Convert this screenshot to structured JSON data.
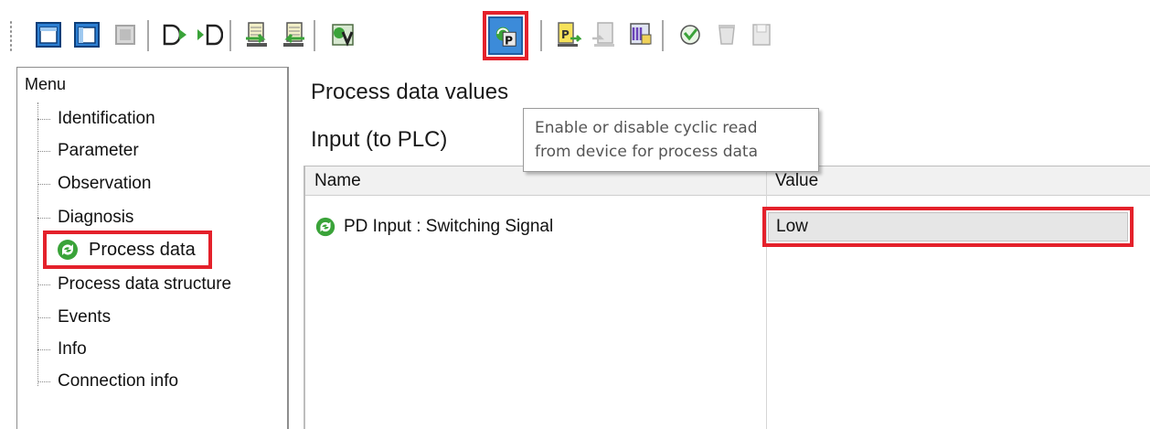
{
  "toolbar": {
    "buttons": [
      {
        "name": "view-layout-1-icon",
        "state": "active"
      },
      {
        "name": "view-layout-2-icon",
        "state": "active"
      },
      {
        "name": "view-layout-3-icon",
        "state": "disabled"
      },
      {
        "name": "connect-icon",
        "state": "active"
      },
      {
        "name": "disconnect-icon",
        "state": "active"
      },
      {
        "name": "upload-from-device-icon",
        "state": "active"
      },
      {
        "name": "download-to-device-icon",
        "state": "active"
      },
      {
        "name": "verify-icon",
        "state": "active"
      },
      {
        "name": "cyclic-process-data-icon",
        "state": "highlighted"
      },
      {
        "name": "parameter-read-icon",
        "state": "active"
      },
      {
        "name": "parameter-write-icon",
        "state": "disabled"
      },
      {
        "name": "device-report-icon",
        "state": "active"
      },
      {
        "name": "refresh-icon",
        "state": "active"
      },
      {
        "name": "delete-icon",
        "state": "disabled"
      },
      {
        "name": "save-icon",
        "state": "disabled"
      }
    ]
  },
  "menu": {
    "title": "Menu",
    "items": [
      {
        "label": "Identification"
      },
      {
        "label": "Parameter"
      },
      {
        "label": "Observation"
      },
      {
        "label": "Diagnosis"
      },
      {
        "label": "Process data",
        "selected": true
      },
      {
        "label": "Process data structure"
      },
      {
        "label": "Events"
      },
      {
        "label": "Info"
      },
      {
        "label": "Connection info"
      }
    ]
  },
  "content": {
    "title": "Process data values",
    "section": "Input (to PLC)",
    "columns": {
      "name": "Name",
      "value": "Value"
    },
    "rows": [
      {
        "name": "PD Input : Switching Signal",
        "value": "Low"
      }
    ]
  },
  "tooltip": {
    "line1": "Enable or disable cyclic read",
    "line2": "from device for process data"
  },
  "colors": {
    "highlight": "#e4212b",
    "active_button": "#3c8bd9",
    "icon_green": "#3aa339"
  }
}
